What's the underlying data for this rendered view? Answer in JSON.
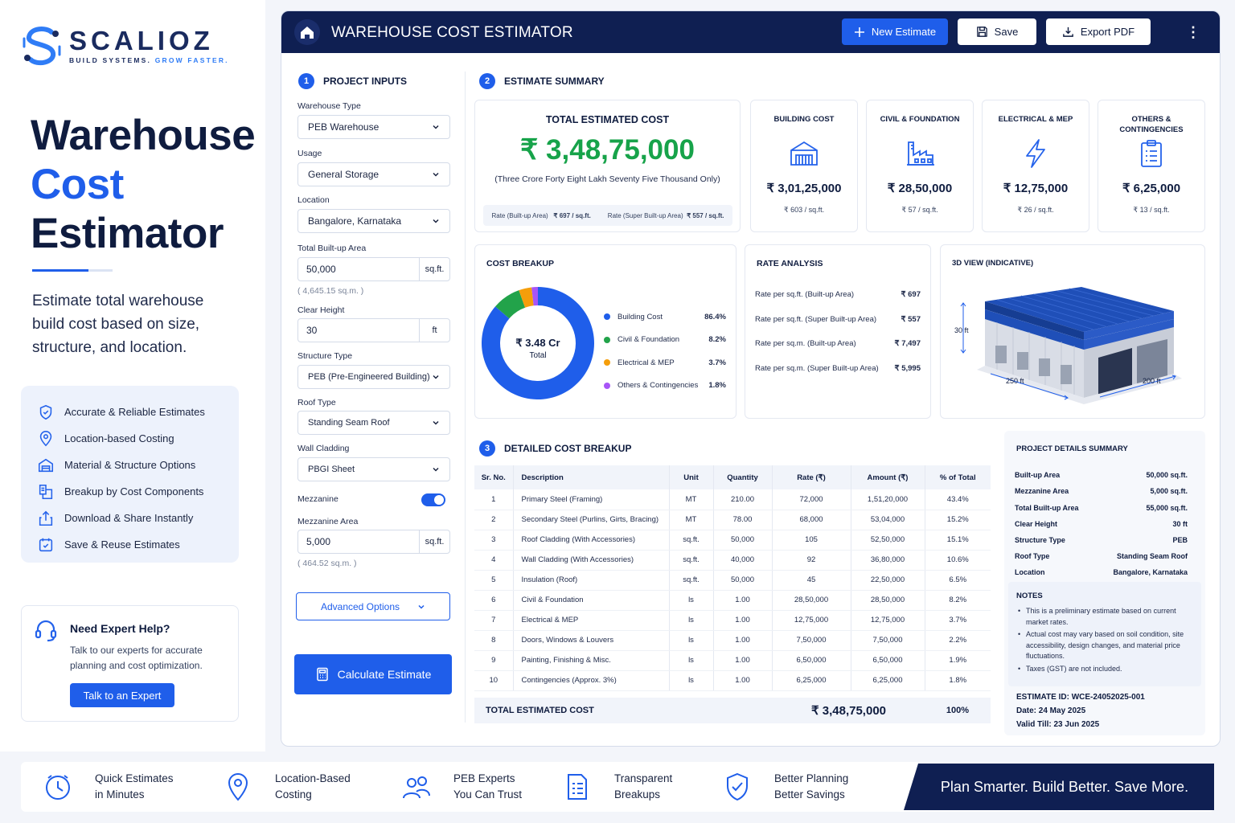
{
  "brand": {
    "name": "SCALIOZ",
    "tag_a": "BUILD SYSTEMS.",
    "tag_b": "GROW FASTER."
  },
  "hero": {
    "line1": "Warehouse",
    "line2": "Cost",
    "line3": "Estimator",
    "description": "Estimate total warehouse build cost based on size, structure, and location."
  },
  "features": [
    {
      "label": "Accurate & Reliable Estimates",
      "icon": "shield-check-icon"
    },
    {
      "label": "Location-based Costing",
      "icon": "location-pin-icon"
    },
    {
      "label": "Material & Structure Options",
      "icon": "building-icon"
    },
    {
      "label": "Breakup by Cost Components",
      "icon": "breakup-icon"
    },
    {
      "label": "Download & Share Instantly",
      "icon": "share-icon"
    },
    {
      "label": "Save & Reuse Estimates",
      "icon": "calendar-check-icon"
    }
  ],
  "help": {
    "title": "Need Expert Help?",
    "text": "Talk to our experts for accurate planning and cost optimization.",
    "button": "Talk to an Expert"
  },
  "topbar": {
    "title": "WAREHOUSE COST ESTIMATOR",
    "new": "New Estimate",
    "save": "Save",
    "export": "Export PDF"
  },
  "inputs": {
    "section_num": "1",
    "section_title": "PROJECT INPUTS",
    "warehouse_type_label": "Warehouse Type",
    "warehouse_type": "PEB Warehouse",
    "usage_label": "Usage",
    "usage": "General Storage",
    "location_label": "Location",
    "location": "Bangalore, Karnataka",
    "area_label": "Total Built-up Area",
    "area": "50,000",
    "area_unit": "sq.ft.",
    "area_hint": "( 4,645.15 sq.m. )",
    "height_label": "Clear Height",
    "height": "30",
    "height_unit": "ft",
    "structure_label": "Structure Type",
    "structure": "PEB (Pre-Engineered Building)",
    "roof_label": "Roof Type",
    "roof": "Standing Seam Roof",
    "wall_label": "Wall Cladding",
    "wall": "PBGI Sheet",
    "mezzanine_label": "Mezzanine",
    "mezzanine_on": true,
    "mezz_area_label": "Mezzanine Area",
    "mezz_area": "5,000",
    "mezz_unit": "sq.ft.",
    "mezz_hint": "( 464.52 sq.m. )",
    "advanced": "Advanced Options",
    "calculate": "Calculate Estimate"
  },
  "summary": {
    "section_num": "2",
    "section_title": "ESTIMATE SUMMARY",
    "total_title": "TOTAL ESTIMATED COST",
    "total_value": "₹ 3,48,75,000",
    "total_words": "(Three Crore Forty Eight Lakh Seventy Five Thousand Only)",
    "rate_builtup_label": "Rate (Built-up Area)",
    "rate_builtup": "₹ 697 / sq.ft.",
    "rate_super_label": "Rate (Super Built-up Area)",
    "rate_super": "₹ 557 / sq.ft.",
    "cards": [
      {
        "title": "BUILDING COST",
        "icon": "warehouse-icon",
        "value": "₹ 3,01,25,000",
        "rate": "₹ 603 / sq.ft."
      },
      {
        "title": "CIVIL & FOUNDATION",
        "icon": "factory-icon",
        "value": "₹ 28,50,000",
        "rate": "₹ 57 / sq.ft."
      },
      {
        "title": "ELECTRICAL & MEP",
        "icon": "lightning-icon",
        "value": "₹ 12,75,000",
        "rate": "₹ 26 / sq.ft."
      },
      {
        "title": "OTHERS & CONTINGENCIES",
        "icon": "clipboard-icon",
        "value": "₹ 6,25,000",
        "rate": "₹ 13 / sq.ft."
      }
    ]
  },
  "breakup": {
    "title": "COST BREAKUP",
    "center_value": "₹ 3.48 Cr",
    "center_label": "Total",
    "items": [
      {
        "name": "Building Cost",
        "pct": "86.4%",
        "value": 86.4,
        "color": "#1f5eea"
      },
      {
        "name": "Civil & Foundation",
        "pct": "8.2%",
        "value": 8.2,
        "color": "#22a34a"
      },
      {
        "name": "Electrical & MEP",
        "pct": "3.7%",
        "value": 3.7,
        "color": "#f59e0b"
      },
      {
        "name": "Others & Contingencies",
        "pct": "1.8%",
        "value": 1.8,
        "color": "#a855f7"
      }
    ]
  },
  "rates": {
    "title": "RATE ANALYSIS",
    "rows": [
      {
        "label": "Rate per sq.ft. (Built-up Area)",
        "value": "₹ 697"
      },
      {
        "label": "Rate per sq.ft. (Super Built-up Area)",
        "value": "₹ 557"
      },
      {
        "label": "Rate per sq.m. (Built-up Area)",
        "value": "₹ 7,497"
      },
      {
        "label": "Rate per sq.m. (Super Built-up Area)",
        "value": "₹ 5,995"
      }
    ]
  },
  "view3d": {
    "title": "3D VIEW (INDICATIVE)",
    "height": "30 ft",
    "length": "250 ft",
    "width": "200 ft"
  },
  "table": {
    "section_num": "3",
    "section_title": "DETAILED COST BREAKUP",
    "headers": [
      "Sr. No.",
      "Description",
      "Unit",
      "Quantity",
      "Rate (₹)",
      "Amount (₹)",
      "% of Total"
    ],
    "rows": [
      [
        "1",
        "Primary Steel (Framing)",
        "MT",
        "210.00",
        "72,000",
        "1,51,20,000",
        "43.4%"
      ],
      [
        "2",
        "Secondary Steel (Purlins, Girts, Bracing)",
        "MT",
        "78.00",
        "68,000",
        "53,04,000",
        "15.2%"
      ],
      [
        "3",
        "Roof Cladding (With Accessories)",
        "sq.ft.",
        "50,000",
        "105",
        "52,50,000",
        "15.1%"
      ],
      [
        "4",
        "Wall Cladding (With Accessories)",
        "sq.ft.",
        "40,000",
        "92",
        "36,80,000",
        "10.6%"
      ],
      [
        "5",
        "Insulation (Roof)",
        "sq.ft.",
        "50,000",
        "45",
        "22,50,000",
        "6.5%"
      ],
      [
        "6",
        "Civil & Foundation",
        "ls",
        "1.00",
        "28,50,000",
        "28,50,000",
        "8.2%"
      ],
      [
        "7",
        "Electrical & MEP",
        "ls",
        "1.00",
        "12,75,000",
        "12,75,000",
        "3.7%"
      ],
      [
        "8",
        "Doors, Windows & Louvers",
        "ls",
        "1.00",
        "7,50,000",
        "7,50,000",
        "2.2%"
      ],
      [
        "9",
        "Painting, Finishing & Misc.",
        "ls",
        "1.00",
        "6,50,000",
        "6,50,000",
        "1.9%"
      ],
      [
        "10",
        "Contingencies (Approx. 3%)",
        "ls",
        "1.00",
        "6,25,000",
        "6,25,000",
        "1.8%"
      ]
    ],
    "total_label": "TOTAL ESTIMATED COST",
    "total_amount": "₹ 3,48,75,000",
    "total_pct": "100%"
  },
  "details": {
    "title": "PROJECT DETAILS SUMMARY",
    "rows": [
      {
        "k": "Built-up Area",
        "v": "50,000 sq.ft."
      },
      {
        "k": "Mezzanine Area",
        "v": "5,000 sq.ft."
      },
      {
        "k": "Total Built-up Area",
        "v": "55,000 sq.ft."
      },
      {
        "k": "Clear Height",
        "v": "30 ft"
      },
      {
        "k": "Structure Type",
        "v": "PEB"
      },
      {
        "k": "Roof Type",
        "v": "Standing Seam Roof"
      },
      {
        "k": "Location",
        "v": "Bangalore, Karnataka"
      }
    ],
    "notes_title": "NOTES",
    "notes": [
      "This is a preliminary estimate based on current market rates.",
      "Actual cost may vary based on soil condition, site accessibility, design changes, and material price fluctuations.",
      "Taxes (GST) are not included."
    ],
    "estimate_id": "ESTIMATE ID: WCE-24052025-001",
    "date": "Date: 24 May 2025",
    "valid": "Valid Till: 23 Jun 2025"
  },
  "footer": {
    "items": [
      {
        "line1": "Quick Estimates",
        "line2": "in Minutes",
        "icon": "clock-icon"
      },
      {
        "line1": "Location-Based",
        "line2": "Costing",
        "icon": "location-pin-icon"
      },
      {
        "line1": "PEB Experts",
        "line2": "You Can Trust",
        "icon": "experts-icon"
      },
      {
        "line1": "Transparent",
        "line2": "Breakups",
        "icon": "document-list-icon"
      },
      {
        "line1": "Better Planning",
        "line2": "Better Savings",
        "icon": "shield-check-icon"
      }
    ],
    "banner": "Plan Smarter. Build Better. Save More."
  }
}
